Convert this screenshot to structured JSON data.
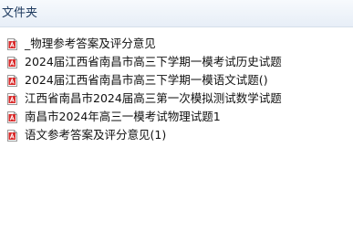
{
  "header": {
    "title": "文件夹"
  },
  "files": [
    {
      "name": "_物理参考答案及评分意见",
      "icon": "pdf-file-icon"
    },
    {
      "name": "2024届江西省南昌市高三下学期一模考试历史试题",
      "icon": "pdf-file-icon"
    },
    {
      "name": "2024届江西省南昌市高三下学期一模语文试题()",
      "icon": "pdf-file-icon"
    },
    {
      "name": "江西省南昌市2024届高三第一次模拟测试数学试题",
      "icon": "pdf-file-icon"
    },
    {
      "name": "南昌市2024年高三一模考试物理试题1",
      "icon": "pdf-file-icon"
    },
    {
      "name": "语文参考答案及评分意见(1)",
      "icon": "pdf-file-icon"
    }
  ],
  "colors": {
    "pdf_icon": "#d92b2b",
    "header_text": "#1e3a5f",
    "header_bg": "#eef3f9"
  }
}
